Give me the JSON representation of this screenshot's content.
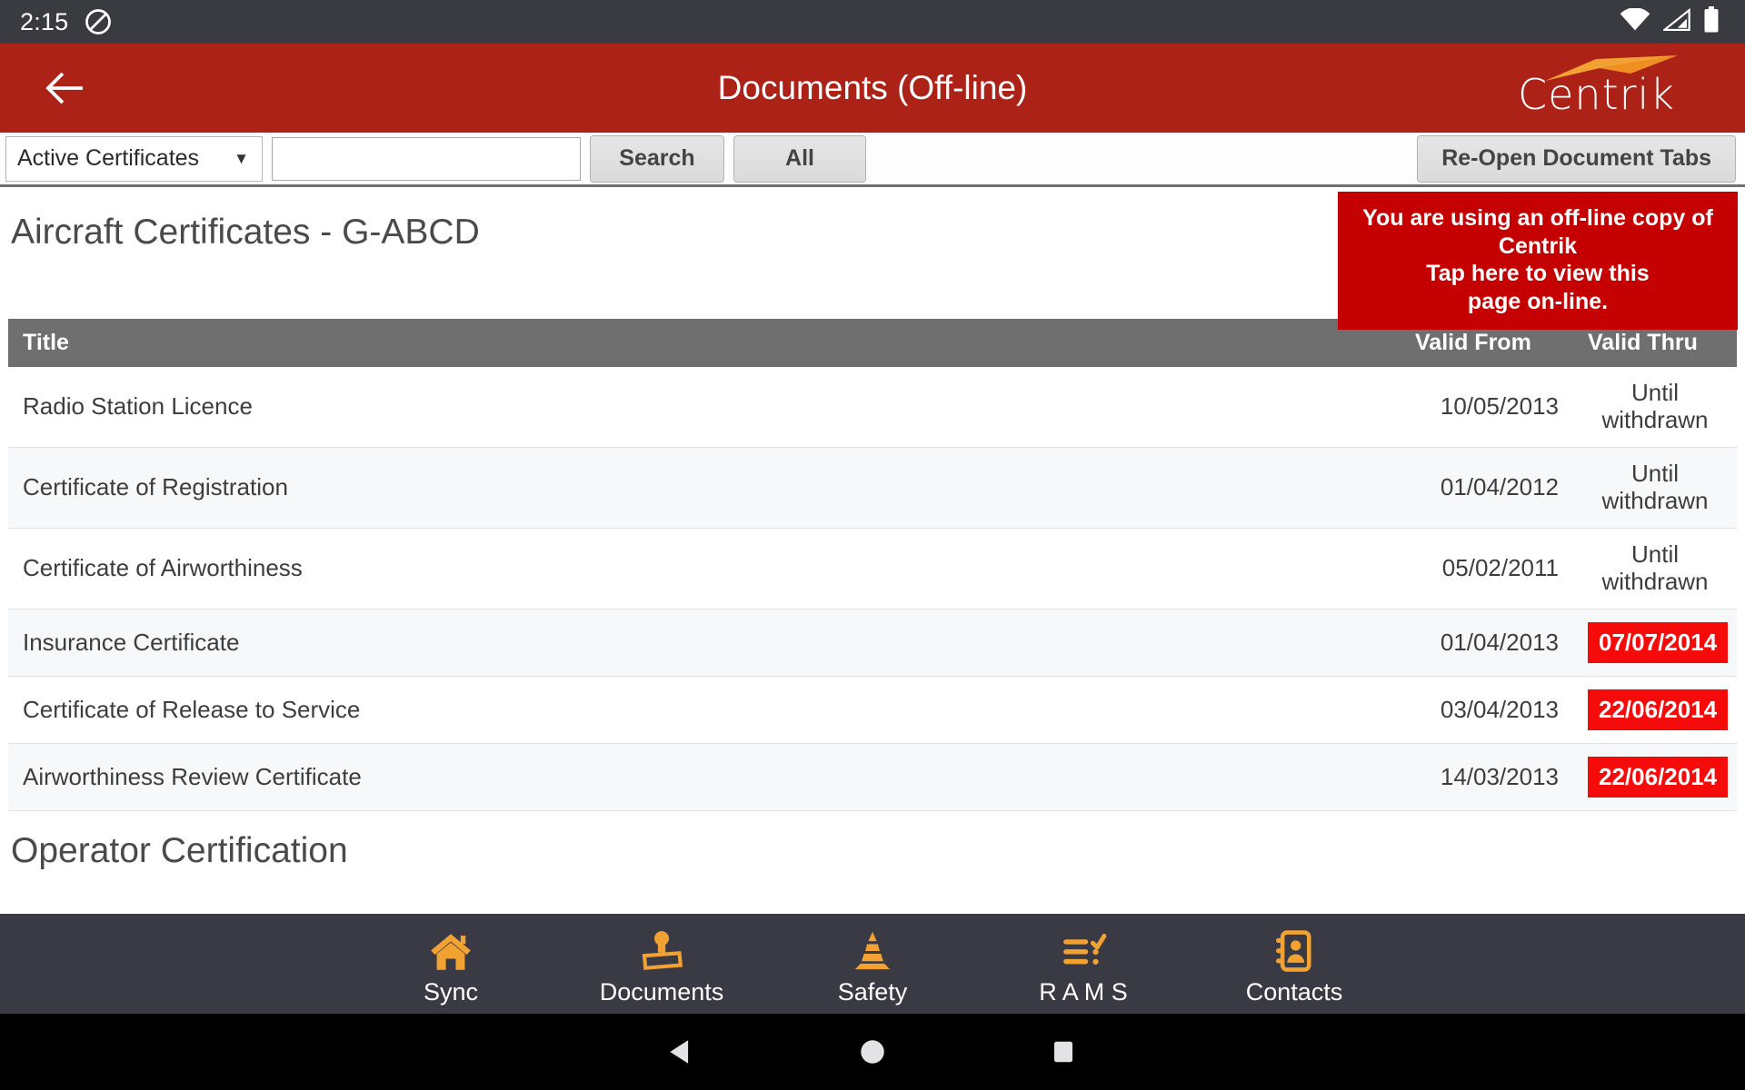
{
  "status_bar": {
    "time": "2:15",
    "icons": [
      "do-not-disturb-icon",
      "wifi-icon",
      "cellular-signal-icon",
      "battery-icon"
    ]
  },
  "app_bar": {
    "back_label": "Back",
    "title": "Documents (Off-line)",
    "logo_text": "Centrik",
    "background_color": "#ac2217",
    "logo_accent_color": "#f2a233"
  },
  "toolbar": {
    "filter_value": "Active Certificates",
    "filter_caret": "▼",
    "search_value": "",
    "search_placeholder": "",
    "search_label": "Search",
    "all_label": "All",
    "reopen_label": "Re-Open Document Tabs"
  },
  "page": {
    "title": "Aircraft Certificates - G-ABCD",
    "offline_banner": {
      "line1": "You are using an off-line copy of",
      "line2": "Centrik",
      "line3": "Tap here to view this",
      "line4": "page on-line.",
      "color": "#c40000"
    },
    "section_title": "Operator Certification"
  },
  "table": {
    "headers": {
      "title": "Title",
      "valid_from": "Valid From",
      "valid_thru": "Valid Thru"
    },
    "rows": [
      {
        "title": "Radio Station Licence",
        "valid_from": "10/05/2013",
        "valid_thru": "Until withdrawn",
        "expired": false
      },
      {
        "title": "Certificate of Registration",
        "valid_from": "01/04/2012",
        "valid_thru": "Until withdrawn",
        "expired": false
      },
      {
        "title": "Certificate of Airworthiness",
        "valid_from": "05/02/2011",
        "valid_thru": "Until withdrawn",
        "expired": false
      },
      {
        "title": "Insurance Certificate",
        "valid_from": "01/04/2013",
        "valid_thru": "07/07/2014",
        "expired": true
      },
      {
        "title": "Certificate of Release to Service",
        "valid_from": "03/04/2013",
        "valid_thru": "22/06/2014",
        "expired": true
      },
      {
        "title": "Airworthiness Review Certificate",
        "valid_from": "14/03/2013",
        "valid_thru": "22/06/2014",
        "expired": true
      }
    ],
    "expired_badge_color": "#f60b0b",
    "header_background": "#6f6f6f"
  },
  "bottom_nav": {
    "accent_color": "#f2a233",
    "background_color": "#393a43",
    "items": [
      {
        "label": "Sync",
        "icon": "home-icon"
      },
      {
        "label": "Documents",
        "icon": "stamp-icon"
      },
      {
        "label": "Safety",
        "icon": "traffic-cone-icon"
      },
      {
        "label": "R A M S",
        "icon": "checklist-icon"
      },
      {
        "label": "Contacts",
        "icon": "address-book-icon"
      }
    ]
  },
  "system_nav": {
    "back_label": "Back",
    "home_label": "Home",
    "recents_label": "Recents"
  }
}
